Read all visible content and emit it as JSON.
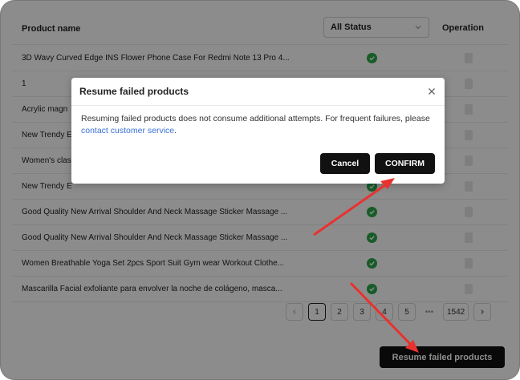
{
  "table": {
    "headers": {
      "product_name": "Product name",
      "status_filter": "All Status",
      "operation": "Operation"
    },
    "rows": [
      {
        "name": "3D Wavy Curved Edge INS Flower Phone Case For Redmi Note 13 Pro 4..."
      },
      {
        "name": "1"
      },
      {
        "name": "Acrylic magn"
      },
      {
        "name": "New Trendy E"
      },
      {
        "name": "Women's clas"
      },
      {
        "name": "New Trendy E"
      },
      {
        "name": "Good Quality New Arrival Shoulder And Neck Massage Sticker Massage ..."
      },
      {
        "name": "Good Quality New Arrival Shoulder And Neck Massage Sticker Massage ..."
      },
      {
        "name": "Women Breathable Yoga Set 2pcs Sport Suit Gym wear Workout Clothe..."
      },
      {
        "name": "Mascarilla Facial exfoliante para envolver la noche de colágeno, masca..."
      }
    ]
  },
  "pagination": {
    "pages": [
      "1",
      "2",
      "3",
      "4",
      "5"
    ],
    "ellipsis": "•••",
    "last": "1542",
    "current": "1"
  },
  "actions": {
    "resume_label": "Resume failed products"
  },
  "modal": {
    "title": "Resume failed products",
    "body": "Resuming failed products does not consume additional attempts. For frequent failures, please ",
    "link": "contact customer service",
    "body_end": ".",
    "cancel_label": "Cancel",
    "confirm_label": "CONFIRM"
  },
  "colors": {
    "success": "#2aa84a",
    "button": "#111111",
    "link": "#3a6fd8",
    "arrow": "#e8322f"
  }
}
